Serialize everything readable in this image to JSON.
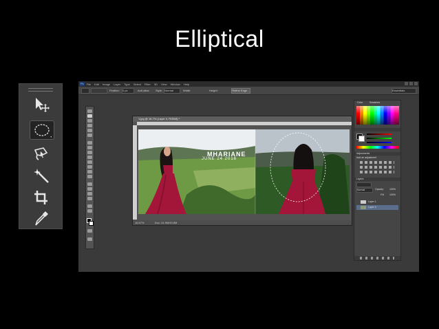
{
  "slide": {
    "title": "Elliptical"
  },
  "tools_enlarged": [
    {
      "name": "move-tool-icon"
    },
    {
      "name": "elliptical-marquee-icon",
      "active": true
    },
    {
      "name": "lasso-tool-icon"
    },
    {
      "name": "magic-wand-icon"
    },
    {
      "name": "crop-tool-icon"
    },
    {
      "name": "eyedropper-icon"
    }
  ],
  "photoshop": {
    "logo": "Ps",
    "menu": [
      "File",
      "Edit",
      "Image",
      "Layer",
      "Type",
      "Select",
      "Filter",
      "3D",
      "View",
      "Window",
      "Help"
    ],
    "options": {
      "feather_label": "Feather:",
      "feather_value": "0 px",
      "antialias_label": "Anti-alias",
      "style_label": "Style:",
      "style_value": "Normal",
      "width_label": "Width:",
      "height_label": "Height:",
      "refine_edge": "Refine Edge...",
      "workspace": "Essentials"
    },
    "document": {
      "tab": "1.jpg @ 16.7% (Layer 0, RGB/8) *",
      "zoom": "16.67%",
      "doc_size": "Doc: 24.9M/49.8M",
      "overlay_name": "MHARIANE",
      "overlay_date": "JUNE 24 2016"
    },
    "panels": {
      "tabs": [
        "Color",
        "Swatches"
      ],
      "adjustments_title": "Adjustments",
      "adjustments_hint": "Add an adjustment",
      "layers_tab": "Layers",
      "blend_mode": "Normal",
      "opacity_label": "Opacity:",
      "opacity_value": "100%",
      "fill_label": "Fill:",
      "fill_value": "100%",
      "layers": [
        "Layer 1",
        "Layer 0"
      ]
    }
  },
  "colors": {
    "dress": "#a3163a",
    "sky_left": "#e9ecef",
    "sky_right": "#b9c2c8",
    "field": "#6f9a45"
  }
}
